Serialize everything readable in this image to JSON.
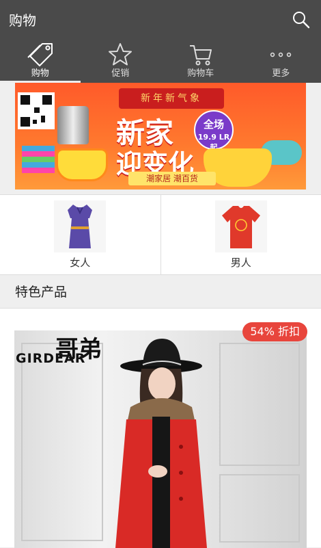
{
  "app": {
    "title": "购物"
  },
  "icons": {
    "search": "search-icon"
  },
  "tabs": [
    {
      "label": "购物",
      "icon": "tag-icon",
      "active": true
    },
    {
      "label": "促销",
      "icon": "star-icon",
      "active": false
    },
    {
      "label": "购物车",
      "icon": "cart-icon",
      "active": false
    },
    {
      "label": "更多",
      "icon": "more-dots-icon",
      "active": false
    }
  ],
  "banner": {
    "top_text": "新年新气象",
    "headline1": "新家",
    "headline2": "迎变化",
    "badge_line1": "全场",
    "badge_line2": "19.9 LR起",
    "strip": "潮家居 潮百货"
  },
  "categories": [
    {
      "label": "女人"
    },
    {
      "label": "男人"
    }
  ],
  "featured": {
    "title": "特色产品",
    "discount_badge": "54% 折扣",
    "brand_text": "GIRDEAR",
    "brand_logo": "哥弟"
  },
  "colors": {
    "appbar": "#4a4a4a",
    "discount": "#e8453c",
    "dress": "#5a4aa8",
    "shirt": "#e0392b"
  }
}
